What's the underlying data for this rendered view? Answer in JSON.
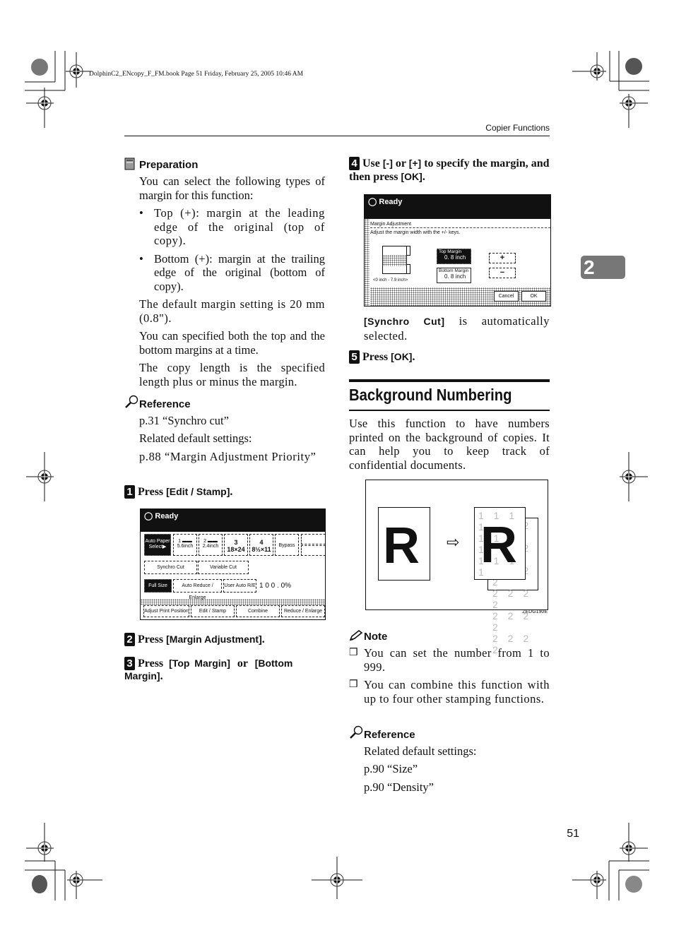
{
  "print_header": "DolphinC2_ENcopy_F_FM.book  Page 51  Friday, February 25, 2005  10:46 AM",
  "running_head": "Copier Functions",
  "chapter_tab": "2",
  "page_number": "51",
  "left": {
    "preparation": {
      "heading": "Preparation",
      "intro": "You can select the following types of margin for this function:",
      "bullets": [
        "Top (+): margin at the leading edge of the original (top of copy).",
        "Bottom (+): margin at the trailing edge of the original (bottom of copy)."
      ],
      "paras": [
        "The default margin setting is 20 mm (0.8\").",
        "You can specified both the top and the bottom margins at a time.",
        "The copy length is the specified length plus or minus the margin."
      ]
    },
    "reference": {
      "heading": "Reference",
      "lines": [
        "p.31 “Synchro cut”",
        "Related default settings:",
        "p.88 “Margin Adjustment Priority”"
      ]
    },
    "steps": [
      {
        "num": "1",
        "pre": "Press ",
        "kbd": "[Edit / Stamp]",
        "post": "."
      },
      {
        "num": "2",
        "pre": "Press ",
        "kbd": "[Margin Adjustment]",
        "post": "."
      },
      {
        "num": "3",
        "pre": "Press ",
        "kbd": "[Top Margin]",
        "mid": " or ",
        "kbd2": "[Bottom Margin]",
        "post": "."
      }
    ],
    "screen1": {
      "status": "Ready",
      "paper": [
        "Auto Paper Select▶",
        "1 ▬▬ 5.6inch",
        "2 ▬▬ 2.4inch",
        "3 18×24",
        "4 8½×11",
        "Bypass"
      ],
      "cut": [
        "Synchro Cut",
        "Variable Cut"
      ],
      "ratio": [
        "Full Size",
        "Auto Reduce / Enlarge",
        "User Auto R/E"
      ],
      "ratio_value": "1 0 0 . 0%",
      "tabs": [
        "Adjust Print Position",
        "Edit / Stamp",
        "Combine",
        "Reduce / Enlarge"
      ]
    }
  },
  "right": {
    "step4": {
      "num": "4",
      "text_a": "Use ",
      "kbd_a": "[-]",
      "text_b": " or ",
      "kbd_b": "[+]",
      "text_c": " to specify the margin, and then press ",
      "kbd_c": "[OK]",
      "text_d": "."
    },
    "screen2": {
      "status": "Ready",
      "title": "Margin Adjustment",
      "instruction": "Adjust the margin width with the +/- keys.",
      "top_label": "Top Margin",
      "top_value": "0. 8 inch",
      "bottom_label": "Bottom Margin",
      "bottom_value": "0. 8 inch",
      "plus": "+",
      "minus": "−",
      "range": "<0 inch - 7.9 inch>",
      "cancel": "Cancel",
      "ok": "OK"
    },
    "synchro_note_kbd": "[Synchro Cut]",
    "synchro_note_text": " is automatically selected.",
    "step5": {
      "num": "5",
      "pre": "Press ",
      "kbd": "[OK]",
      "post": "."
    },
    "section_title": "Background Numbering",
    "section_intro": "Use this function to have numbers printed on the background of copies. It can help you to keep track of confidential documents.",
    "figure": {
      "letter": "R",
      "arrow": "⇨",
      "num1": "1",
      "num2": "2",
      "caption": "ZEDG190E"
    },
    "note": {
      "heading": "Note",
      "items": [
        "You can set the number from 1 to 999.",
        "You can combine this function with up to four other stamping functions."
      ]
    },
    "reference": {
      "heading": "Reference",
      "lines": [
        "Related default settings:",
        "p.90 “Size”",
        "p.90 “Density”"
      ]
    }
  }
}
